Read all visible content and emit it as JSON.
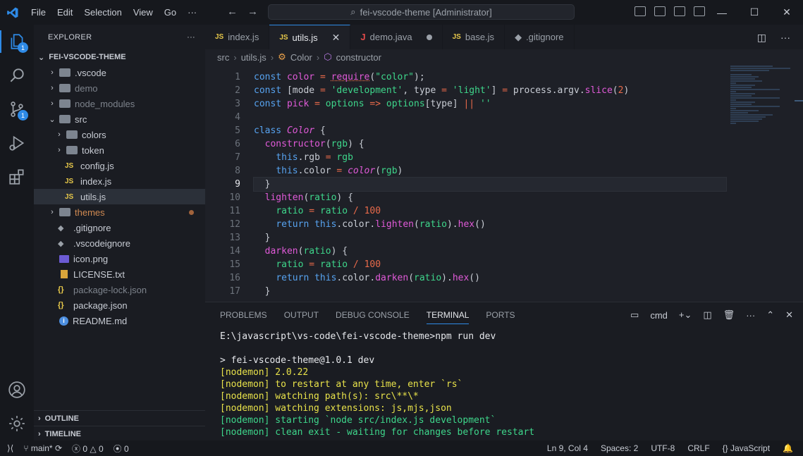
{
  "titlebar": {
    "menu": [
      "File",
      "Edit",
      "Selection",
      "View",
      "Go",
      "···"
    ],
    "command_center": "fei-vscode-theme [Administrator]"
  },
  "activity": {
    "explorer_badge": "1",
    "scm_badge": "1"
  },
  "sidebar": {
    "header": "EXPLORER",
    "more": "···",
    "root": "FEI-VSCODE-THEME",
    "tree": [
      {
        "label": ".vscode",
        "type": "folder",
        "depth": 0,
        "expanded": false
      },
      {
        "label": "demo",
        "type": "folder",
        "depth": 0,
        "expanded": false,
        "dim": true
      },
      {
        "label": "node_modules",
        "type": "folder",
        "depth": 0,
        "expanded": false,
        "dim": true
      },
      {
        "label": "src",
        "type": "folder",
        "depth": 0,
        "expanded": true
      },
      {
        "label": "colors",
        "type": "folder",
        "depth": 1,
        "expanded": false
      },
      {
        "label": "token",
        "type": "folder",
        "depth": 1,
        "expanded": false
      },
      {
        "label": "config.js",
        "type": "js",
        "depth": 1
      },
      {
        "label": "index.js",
        "type": "js",
        "depth": 1
      },
      {
        "label": "utils.js",
        "type": "js",
        "depth": 1,
        "selected": true
      },
      {
        "label": "themes",
        "type": "folder",
        "depth": 0,
        "expanded": false,
        "modified": true
      },
      {
        "label": ".gitignore",
        "type": "git",
        "depth": 0
      },
      {
        "label": ".vscodeignore",
        "type": "git",
        "depth": 0
      },
      {
        "label": "icon.png",
        "type": "png",
        "depth": 0
      },
      {
        "label": "LICENSE.txt",
        "type": "license",
        "depth": 0
      },
      {
        "label": "package-lock.json",
        "type": "json",
        "depth": 0,
        "dim": true
      },
      {
        "label": "package.json",
        "type": "json",
        "depth": 0
      },
      {
        "label": "README.md",
        "type": "info",
        "depth": 0
      }
    ],
    "outline": "OUTLINE",
    "timeline": "TIMELINE"
  },
  "tabs": [
    {
      "label": "index.js",
      "icon": "JS",
      "state": "normal"
    },
    {
      "label": "utils.js",
      "icon": "JS",
      "state": "active"
    },
    {
      "label": "demo.java",
      "icon": "J",
      "state": "dirty"
    },
    {
      "label": "base.js",
      "icon": "JS",
      "state": "normal"
    },
    {
      "label": ".gitignore",
      "icon": "git",
      "state": "normal"
    }
  ],
  "breadcrumb": [
    "src",
    "utils.js",
    "Color",
    "constructor"
  ],
  "editor": {
    "current_line": 9,
    "line_numbers": [
      "1",
      "2",
      "3",
      "4",
      "5",
      "6",
      "7",
      "8",
      "9",
      "10",
      "11",
      "12",
      "13",
      "14",
      "15",
      "16",
      "17"
    ]
  },
  "panel": {
    "tabs": [
      "PROBLEMS",
      "OUTPUT",
      "DEBUG CONSOLE",
      "TERMINAL",
      "PORTS"
    ],
    "active_tab": "TERMINAL",
    "shell": "cmd",
    "terminal": [
      {
        "text": "E:\\javascript\\vs-code\\fei-vscode-theme>npm run dev",
        "color": "plain"
      },
      {
        "text": "",
        "color": "plain"
      },
      {
        "text": "> fei-vscode-theme@1.0.1 dev",
        "color": "plain"
      },
      {
        "text": "[nodemon] 2.0.22",
        "color": "yellow"
      },
      {
        "text": "[nodemon] to restart at any time, enter `rs`",
        "color": "yellow"
      },
      {
        "text": "[nodemon] watching path(s): src\\**\\*",
        "color": "yellow"
      },
      {
        "text": "[nodemon] watching extensions: js,mjs,json",
        "color": "yellow"
      },
      {
        "text": "[nodemon] starting `node src/index.js development`",
        "color": "green"
      },
      {
        "text": "[nodemon] clean exit - waiting for changes before restart",
        "color": "green"
      }
    ]
  },
  "statusbar": {
    "branch": "main*",
    "errors": "0",
    "warnings": "0",
    "ports": "0",
    "position": "Ln 9, Col 4",
    "spaces": "Spaces: 2",
    "encoding": "UTF-8",
    "eol": "CRLF",
    "language": "JavaScript"
  },
  "colors": {
    "accent": "#2e8ae6",
    "keyword": "#57a3f0",
    "string": "#3ed68b",
    "number": "#e86a4a",
    "function": "#e05ad8"
  }
}
